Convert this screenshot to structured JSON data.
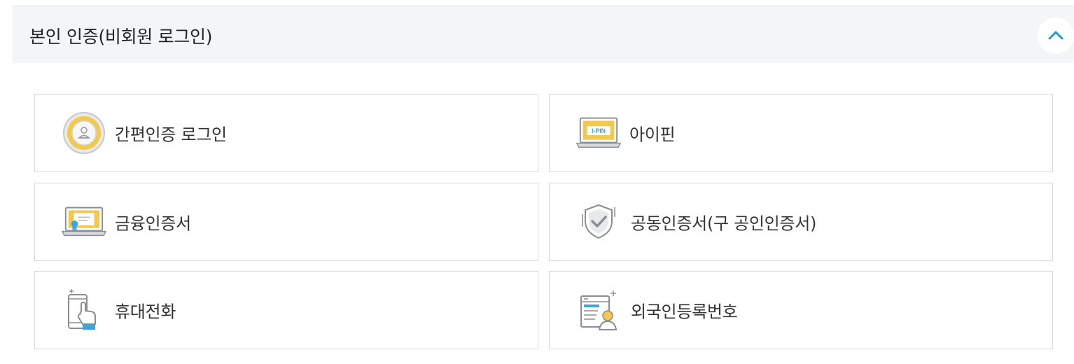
{
  "section": {
    "title": "본인 인증(비회원 로그인)",
    "collapse_icon": "chevron-up-icon",
    "accent_color": "#1a9ad6"
  },
  "methods": [
    {
      "label": "간편인증 로그인",
      "icon": "simple-auth-icon"
    },
    {
      "label": "아이핀",
      "icon": "ipin-icon",
      "icon_text": "I-PIN"
    },
    {
      "label": "금융인증서",
      "icon": "financial-certificate-icon"
    },
    {
      "label": "공동인증서(구 공인인증서)",
      "icon": "joint-certificate-shield-icon"
    },
    {
      "label": "휴대전화",
      "icon": "mobile-phone-icon"
    },
    {
      "label": "외국인등록번호",
      "icon": "foreigner-registration-icon"
    }
  ],
  "colors": {
    "header_bg": "#f4f5f7",
    "border": "#d6d7da",
    "icon_yellow": "#f2c94c",
    "icon_blue": "#3aa6dd",
    "icon_gray": "#8a8d92"
  }
}
